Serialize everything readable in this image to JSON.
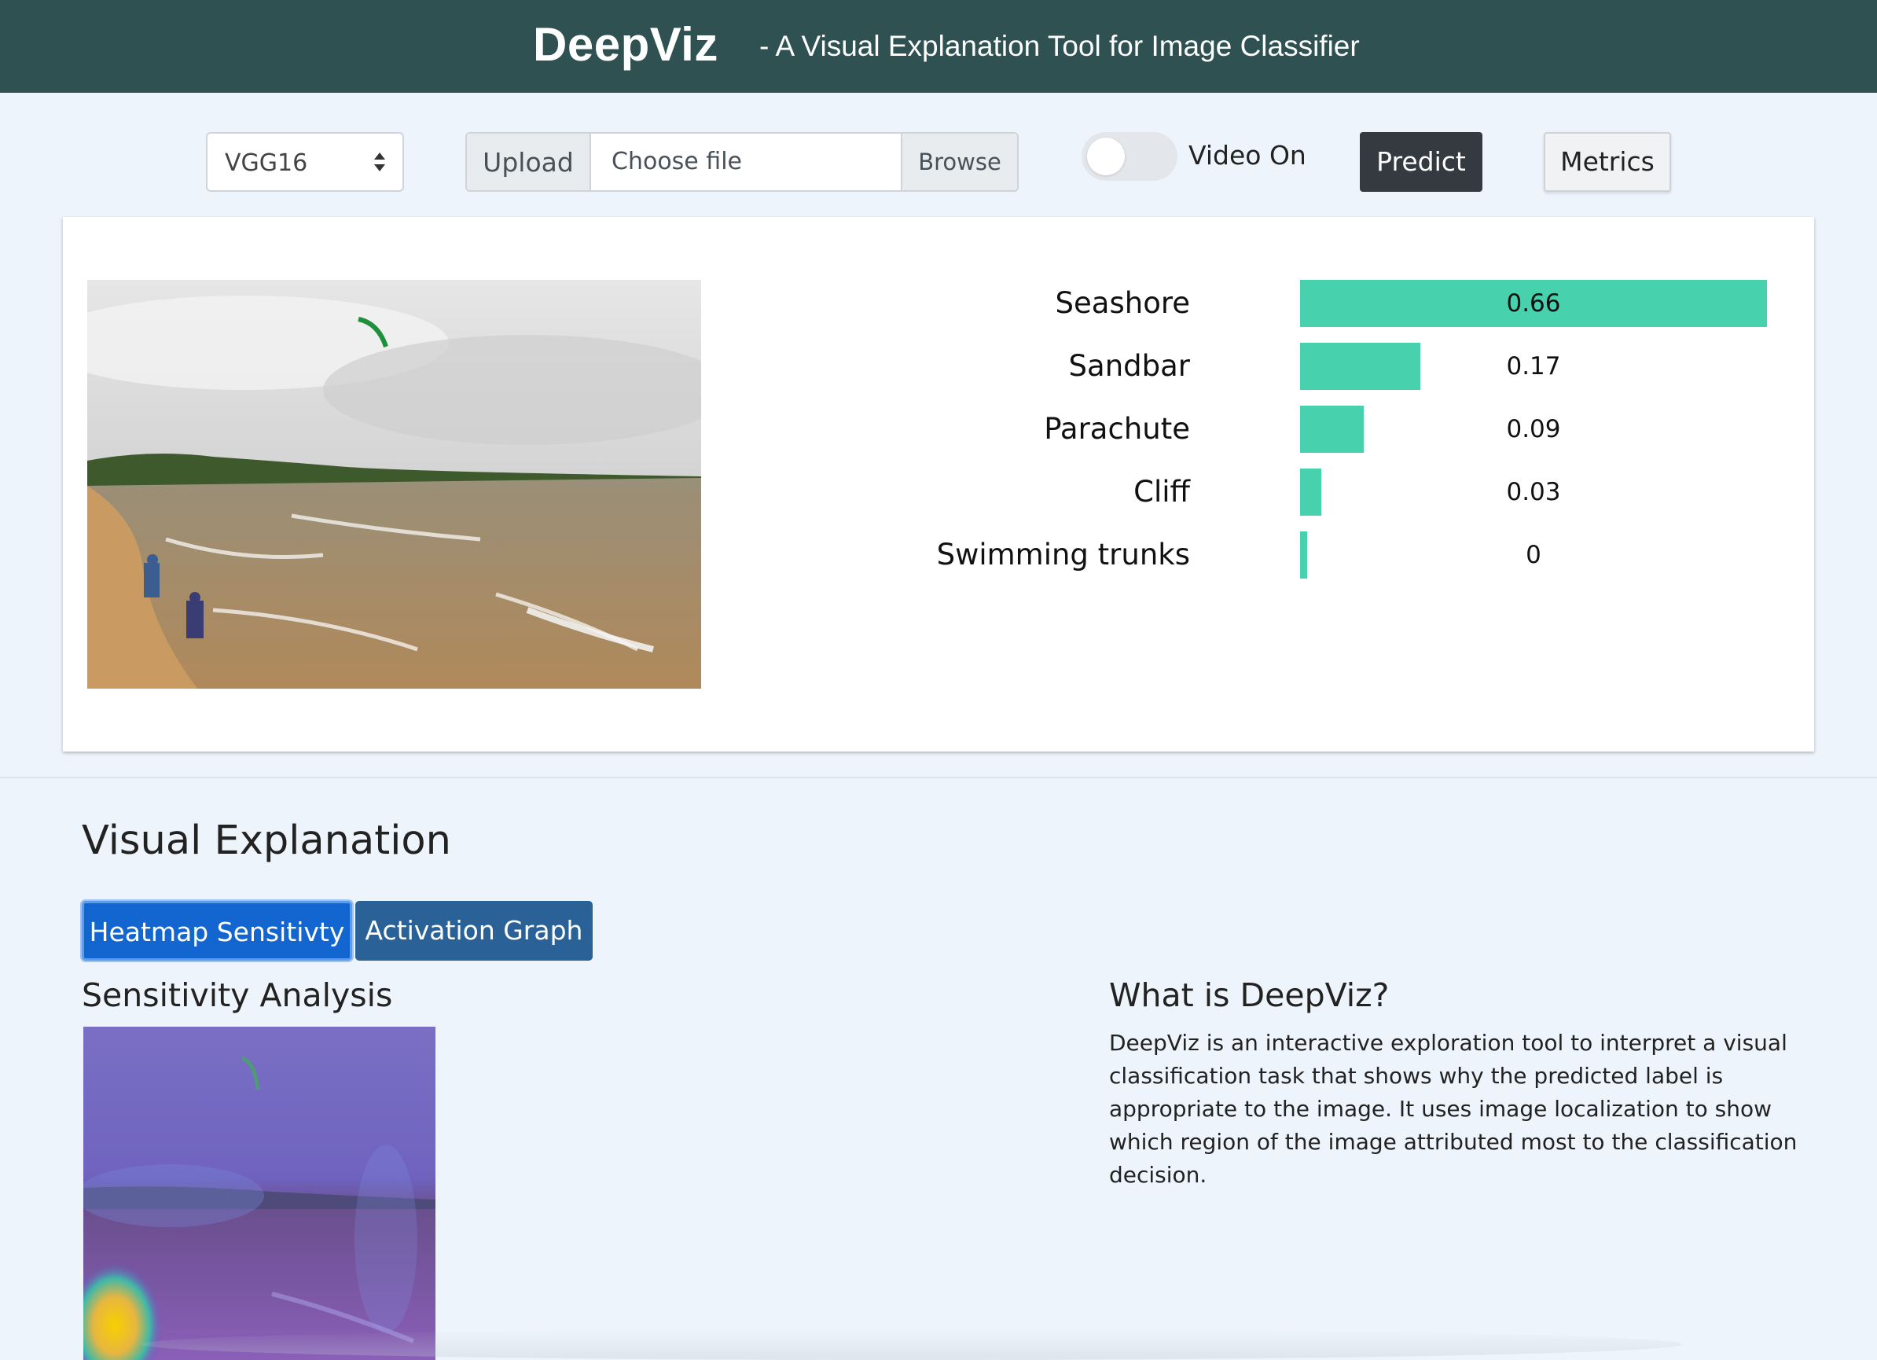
{
  "header": {
    "brand": "DeepViz",
    "tagline": "- A Visual Explanation Tool for Image Classifier"
  },
  "toolbar": {
    "model_select": {
      "value": "VGG16"
    },
    "upload": {
      "label": "Upload",
      "placeholder": "Choose file",
      "browse": "Browse"
    },
    "video_toggle": {
      "label": "Video On",
      "on": false
    },
    "predict_label": "Predict",
    "metrics_label": "Metrics"
  },
  "predictions": {
    "items": [
      {
        "label": "Seashore",
        "value": "0.66",
        "score": 0.66
      },
      {
        "label": "Sandbar",
        "value": "0.17",
        "score": 0.17
      },
      {
        "label": "Parachute",
        "value": "0.09",
        "score": 0.09
      },
      {
        "label": "Cliff",
        "value": "0.03",
        "score": 0.03
      },
      {
        "label": "Swimming trunks",
        "value": "0",
        "score": 0.0
      }
    ],
    "bar_color": "#47d1ad"
  },
  "explanation": {
    "title": "Visual Explanation",
    "tabs": [
      {
        "label": "Heatmap Sensitivty",
        "active": true
      },
      {
        "label": "Activation Graph",
        "active": false
      }
    ],
    "sensitivity_title": "Sensitivity Analysis"
  },
  "about": {
    "title": "What is DeepViz?",
    "text": "DeepViz is an interactive exploration tool to interpret a visual classification task that shows why the predicted label is appropriate to the image. It uses image localization to show which region of the image attributed most to the classification decision."
  },
  "colors": {
    "header_bg": "#2f5152",
    "page_bg": "#eef4fb",
    "predict_bg": "#343a40",
    "tab_active": "#1366cf",
    "tab_inactive": "#2a6196"
  }
}
